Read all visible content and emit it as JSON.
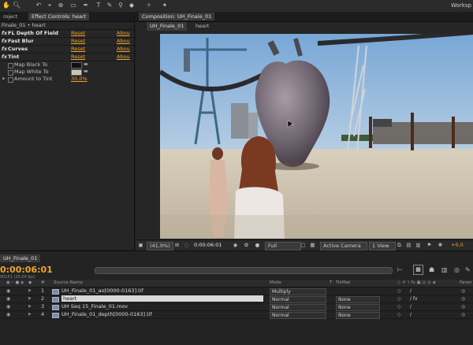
{
  "toolbar": {
    "workspace_label": "Worksp",
    "tools": [
      "hand",
      "zoom",
      "rotate",
      "camera",
      "pan-behind",
      "rect-mask",
      "pen",
      "text",
      "brush",
      "clone-stamp",
      "eraser",
      "roto-brush",
      "puppet"
    ]
  },
  "left_panel": {
    "tab_project": "roject",
    "tab_effect_controls": "Effect Controls: heart",
    "breadcrumb": "Finale_01 • heart",
    "effects": [
      {
        "fx": "fx",
        "name": "FL Depth Of Field",
        "reset": "Reset",
        "about": "Abou"
      },
      {
        "fx": "fx",
        "name": "Fast Blur",
        "reset": "Reset",
        "about": "Abou"
      },
      {
        "fx": "fx",
        "name": "Curves",
        "reset": "Reset",
        "about": "Abou"
      },
      {
        "fx": "fx",
        "name": "Tint",
        "reset": "Reset",
        "about": "Abou"
      }
    ],
    "tint_props": {
      "map_black_label": "Map Black To",
      "map_black_color": "#101010",
      "map_white_label": "Map White To",
      "map_white_color": "#c9c9b8",
      "amount_label": "Amount to Tint",
      "amount_value": "30,0%"
    }
  },
  "comp_panel": {
    "tab_label": "Composition: UH_Finale_01",
    "tab_comp_name": "UH_Finale_01",
    "tab_layer_name": "heart",
    "footer": {
      "zoom": "(41,9%)",
      "timecode": "0:00:06:01",
      "resolution": "Full",
      "camera": "Active Camera",
      "views": "1 View",
      "exposure": "+0,0"
    }
  },
  "timeline": {
    "tab_label": "UH_Finale_01",
    "timecode": "0:00:06:01",
    "fps": "00151 (25.00 fps)",
    "headers": {
      "source_name": "Source Name",
      "mode": "Mode",
      "t": "T",
      "trkmat": "TrkMat",
      "parent": "Paren"
    },
    "layers": [
      {
        "num": "1",
        "name": "UH_Finale_01_ao[0000-0163].tif",
        "mode": "Multiply",
        "trkmat": ""
      },
      {
        "num": "2",
        "name": "heart",
        "mode": "Normal",
        "trkmat": "None"
      },
      {
        "num": "3",
        "name": "UH Seq 15_Finale_01.mov",
        "mode": "Normal",
        "trkmat": "None"
      },
      {
        "num": "4",
        "name": "UH_Finale_01_depth[0000-0163].tif",
        "mode": "Normal",
        "trkmat": "None"
      }
    ]
  },
  "colors": {
    "accent_orange": "#f0a52a",
    "panel_bg": "#262626",
    "sky_blue": "#8fb6dc"
  }
}
